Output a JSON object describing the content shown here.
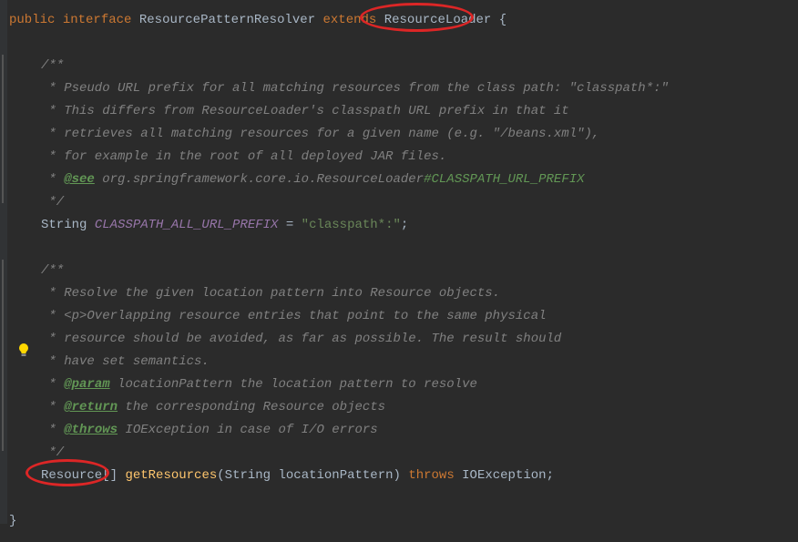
{
  "code": {
    "line1": {
      "public": "public",
      "interface": "interface",
      "className": "ResourcePatternResolver",
      "extends": "extends",
      "parentClass": "ResourceLoader",
      "brace": " {"
    },
    "doc1": {
      "l1": "/**",
      "l2": " * Pseudo URL prefix for all matching resources from the class path: \"classpath*:\"",
      "l3": " * This differs from ResourceLoader's classpath URL prefix in that it",
      "l4": " * retrieves all matching resources for a given name (e.g. \"/beans.xml\"),",
      "l5": " * for example in the root of all deployed JAR files.",
      "l6_star": " * ",
      "l6_tag": "@see",
      "l6_ref": " org.springframework.core.io.ResourceLoader",
      "l6_link": "#CLASSPATH_URL_PREFIX",
      "l7": " */"
    },
    "field1": {
      "type": "String ",
      "name": "CLASSPATH_ALL_URL_PREFIX",
      "eq": " = ",
      "value": "\"classpath*:\"",
      "semi": ";"
    },
    "doc2": {
      "l1": "/**",
      "l2": " * Resolve the given location pattern into Resource objects.",
      "l3": " * <p>Overlapping resource entries that point to the same physical",
      "l4": " * resource should be avoided, as far as possible. The result should",
      "l5": " * have set semantics.",
      "l6_star": " * ",
      "l6_tag": "@param",
      "l6_param": " locationPattern",
      "l6_desc": " the location pattern to resolve",
      "l7_star": " * ",
      "l7_tag": "@return",
      "l7_desc": " the corresponding Resource objects",
      "l8_star": " * ",
      "l8_tag": "@throws",
      "l8_ex": " IOException",
      "l8_desc": " in case of I/O errors",
      "l9": " */"
    },
    "method1": {
      "returnType": "Resource",
      "array": "[] ",
      "name": "getResources",
      "paren1": "(",
      "paramType": "String ",
      "paramName": "locationPattern",
      "paren2": ") ",
      "throws": "throws",
      "exception": " IOException",
      "semi": ";"
    },
    "closeBrace": "}"
  }
}
